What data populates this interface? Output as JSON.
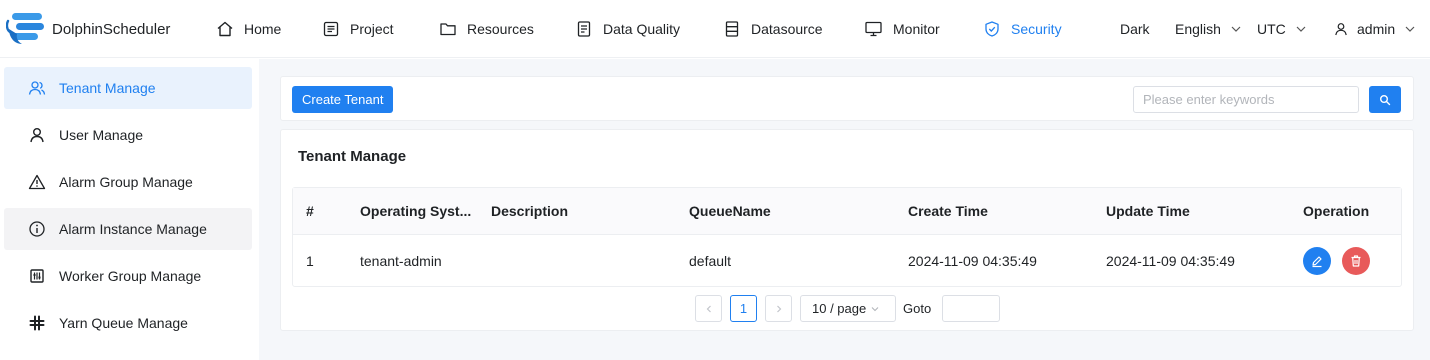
{
  "app": {
    "name": "DolphinScheduler"
  },
  "nav": {
    "items": [
      {
        "label": "Home",
        "icon": "home-icon"
      },
      {
        "label": "Project",
        "icon": "project-icon"
      },
      {
        "label": "Resources",
        "icon": "folder-icon"
      },
      {
        "label": "Data Quality",
        "icon": "data-quality-icon"
      },
      {
        "label": "Datasource",
        "icon": "datasource-icon"
      },
      {
        "label": "Monitor",
        "icon": "monitor-icon"
      },
      {
        "label": "Security",
        "icon": "shield-icon",
        "active": true
      }
    ],
    "theme": "Dark",
    "language": "English",
    "timezone": "UTC",
    "user": "admin"
  },
  "sidebar": {
    "items": [
      {
        "label": "Tenant Manage",
        "icon": "tenant-icon",
        "active": true
      },
      {
        "label": "User Manage",
        "icon": "user-icon"
      },
      {
        "label": "Alarm Group Manage",
        "icon": "warning-icon"
      },
      {
        "label": "Alarm Instance Manage",
        "icon": "info-icon"
      },
      {
        "label": "Worker Group Manage",
        "icon": "worker-group-icon"
      },
      {
        "label": "Yarn Queue Manage",
        "icon": "queue-icon"
      }
    ]
  },
  "toolbar": {
    "create_label": "Create Tenant",
    "search_placeholder": "Please enter keywords"
  },
  "section": {
    "title": "Tenant Manage"
  },
  "table": {
    "columns": [
      "#",
      "Operating Syst...",
      "Description",
      "QueueName",
      "Create Time",
      "Update Time",
      "Operation"
    ],
    "rows": [
      {
        "index": "1",
        "os": "tenant-admin",
        "description": "",
        "queue": "default",
        "create_time": "2024-11-09 04:35:49",
        "update_time": "2024-11-09 04:35:49"
      }
    ]
  },
  "pagination": {
    "current_page": "1",
    "page_size": "10 / page",
    "goto_label": "Goto"
  },
  "colors": {
    "accent": "#2080f0",
    "danger": "#e85a5a",
    "active_bg": "#e9f2fd",
    "page_bg": "#f5f7fa"
  }
}
